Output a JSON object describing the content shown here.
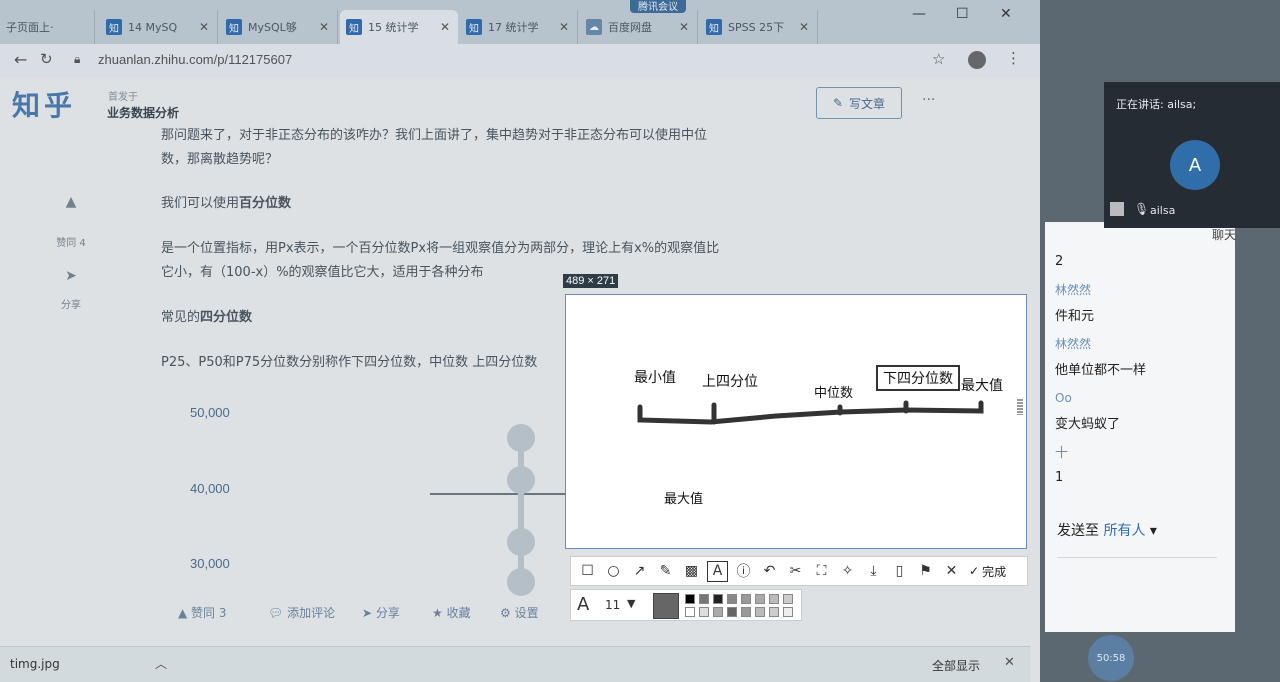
{
  "topbadge": "腾讯会议",
  "tabs": [
    {
      "label": "子页面上·",
      "zh": false
    },
    {
      "label": "14 MySQ",
      "zh": true
    },
    {
      "label": "MySQL够",
      "zh": true
    },
    {
      "label": "15 统计学",
      "zh": true,
      "active": true
    },
    {
      "label": "17 统计学",
      "zh": true
    },
    {
      "label": "百度网盘",
      "zh": false
    },
    {
      "label": "SPSS 25下",
      "zh": true
    }
  ],
  "tab_zh_glyph": "知",
  "address": "zhuanlan.zhihu.com/p/112175607",
  "zhihu": {
    "logo": "知乎",
    "column_small": "首发于",
    "column_title": "业务数据分析",
    "write_button": "写文章",
    "more": "···"
  },
  "article": {
    "p1_line1": "那问题来了，对于非正态分布的该咋办？我们上面讲了，集中趋势对于非正态分布可以使用中位",
    "p1_line2": "数，那离散趋势呢？",
    "p2_prefix": "我们可以使用",
    "p2_bold": "百分位数",
    "p3_line1": "是一个位置指标，用Px表示，一个百分位数Px将一组观察值分为两部分，理论上有x%的观察值比",
    "p3_line2": "它小，有（100-x）%的观察值比它大，适用于各种分布",
    "p4_prefix": "常见的",
    "p4_bold": "四分位数",
    "p5": "P25、P50和P75分位数分别称作下四分位数，中位数 上四分位数"
  },
  "side": {
    "upvote": "赞同 4",
    "share": "分享"
  },
  "chart_axis": [
    "50,000",
    "40,000",
    "30,000"
  ],
  "footer": {
    "agree": "▲ 赞同 3",
    "comment": "添加评论",
    "share": "分享",
    "fav": "收藏",
    "settings": "设置"
  },
  "download": {
    "filename": "timg.jpg",
    "show_all": "全部显示"
  },
  "capture": {
    "size": "489 × 271",
    "labels": {
      "min": "最小值",
      "upper_q": "上四分位",
      "median": "中位数",
      "lower_q": "下四分位数",
      "max": "最大值",
      "max2": "最大值"
    },
    "done": "完成",
    "font_size": "11"
  },
  "meeting": {
    "speaking": "正在讲话: ailsa;",
    "avatar": "A",
    "user": "ailsa",
    "chat_title": "聊天",
    "messages": [
      {
        "name": "",
        "text": "2"
      },
      {
        "name": "林然然",
        "text": "件和元"
      },
      {
        "name": "林然然",
        "text": "他单位都不一样"
      },
      {
        "name": "Oo",
        "text": "变大蚂蚁了"
      },
      {
        "name": "",
        "text": "十"
      },
      {
        "name": "",
        "text": "1"
      }
    ],
    "send_to_label": "发送至",
    "send_to_target": "所有人",
    "timer": "50:58"
  },
  "colors": {
    "accent": "#2f6fb8",
    "zhihu_blue": "#4a7eb8"
  }
}
